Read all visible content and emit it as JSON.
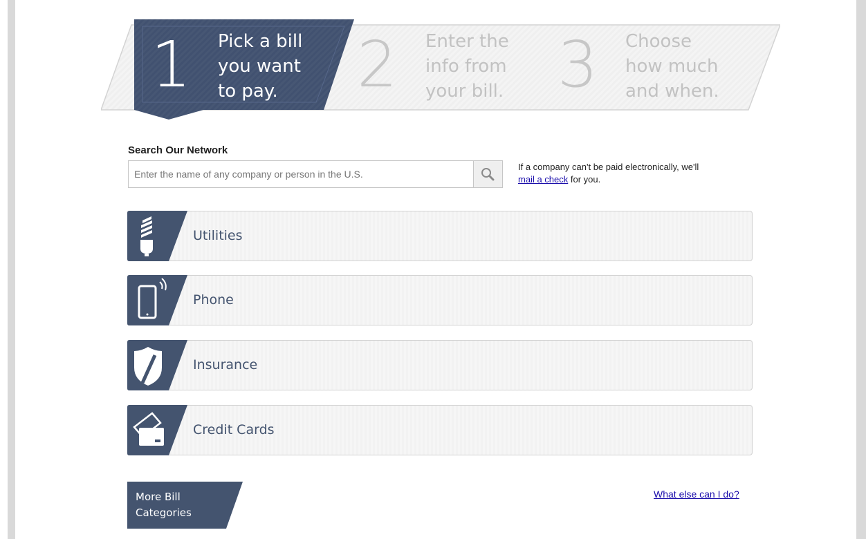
{
  "steps": [
    {
      "number": "1",
      "text": "Pick a bill\nyou want\nto pay.",
      "active": true
    },
    {
      "number": "2",
      "text": "Enter the\ninfo from\nyour bill.",
      "active": false
    },
    {
      "number": "3",
      "text": "Choose\nhow much\nand when.",
      "active": false
    }
  ],
  "search": {
    "heading": "Search Our Network",
    "placeholder": "Enter the name of any company or person in the U.S.",
    "value": "",
    "note_prefix": "If a company can't be paid electronically, we'll",
    "note_link": "mail a check",
    "note_suffix": "for you."
  },
  "categories": [
    {
      "label": "Utilities",
      "icon": "lightbulb-icon"
    },
    {
      "label": "Phone",
      "icon": "mobile-phone-icon"
    },
    {
      "label": "Insurance",
      "icon": "shield-icon"
    },
    {
      "label": "Credit Cards",
      "icon": "credit-card-icon"
    }
  ],
  "more_categories": "More Bill\nCategories",
  "what_else_link": "What else can I do?",
  "colors": {
    "accent": "#44546f",
    "link": "#1a0dab",
    "inactive_step": "#c7c7c7"
  }
}
